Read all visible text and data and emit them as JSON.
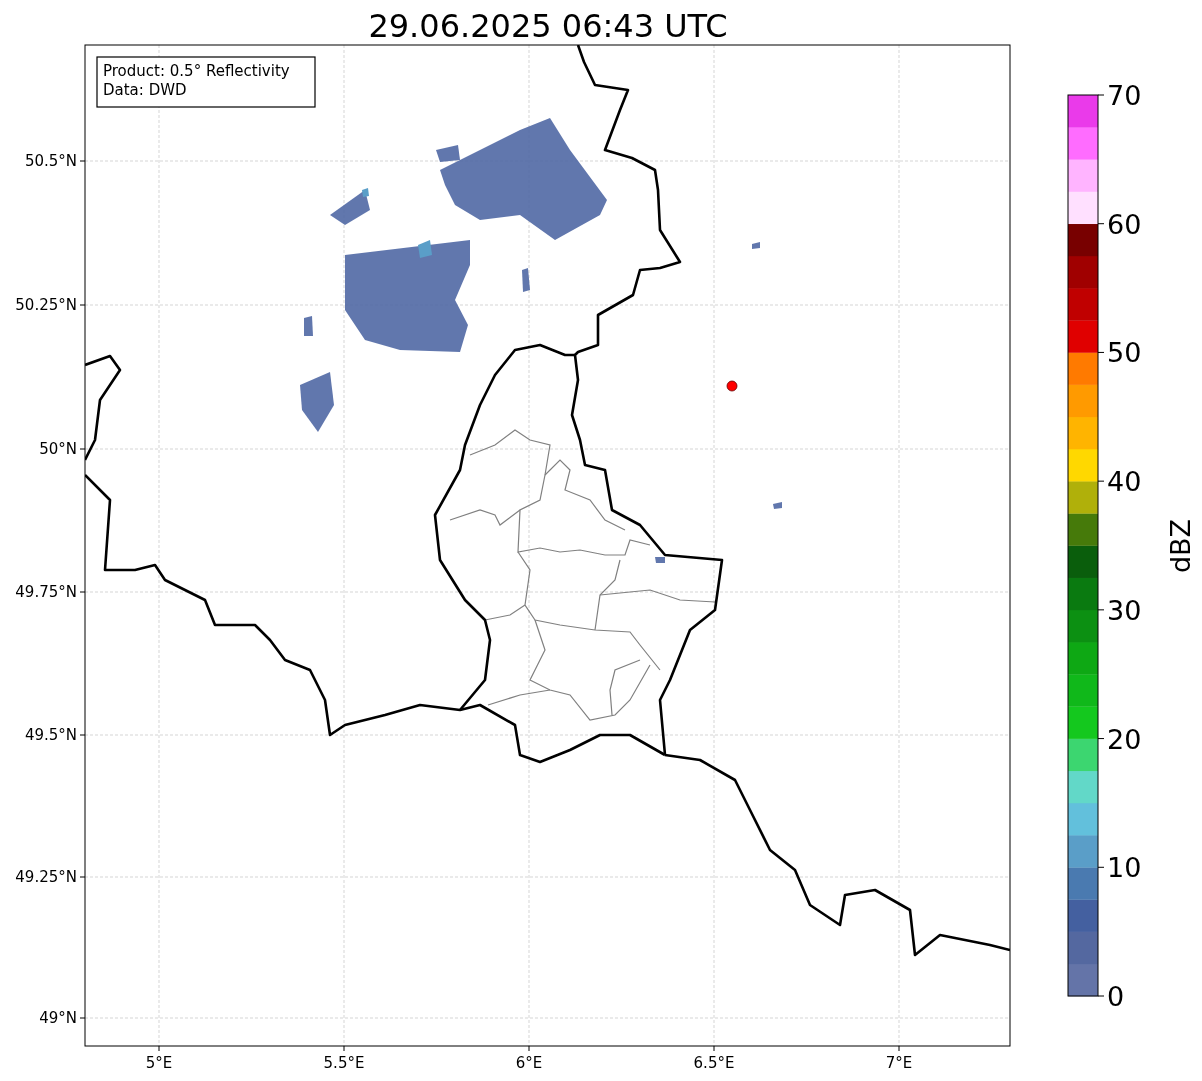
{
  "title": "29.06.2025 06:43 UTC",
  "info_box": {
    "lines": [
      "Product: 0.5° Reflectivity",
      "Data: DWD"
    ]
  },
  "map": {
    "x_ticks": [
      "5°E",
      "5.5°E",
      "6°E",
      "6.5°E",
      "7°E"
    ],
    "y_ticks": [
      "50.5°N",
      "50.25°N",
      "50°N",
      "49.75°N",
      "49.5°N",
      "49.25°N",
      "49°N"
    ]
  },
  "colorbar": {
    "label": "dBZ",
    "ticks": [
      "70",
      "60",
      "50",
      "40",
      "30",
      "20",
      "10",
      "0"
    ],
    "segments": [
      {
        "color": "#6474a8"
      },
      {
        "color": "#5468a0"
      },
      {
        "color": "#4460a0"
      },
      {
        "color": "#4a7ab0"
      },
      {
        "color": "#5a9ec8"
      },
      {
        "color": "#62c0dc"
      },
      {
        "color": "#62d8c8"
      },
      {
        "color": "#3cd670"
      },
      {
        "color": "#14c81e"
      },
      {
        "color": "#10b81a"
      },
      {
        "color": "#0ea814"
      },
      {
        "color": "#0c9012"
      },
      {
        "color": "#0a7a10"
      },
      {
        "color": "#0a5e0c"
      },
      {
        "color": "#467a0a"
      },
      {
        "color": "#b0b00a"
      },
      {
        "color": "#ffd800"
      },
      {
        "color": "#ffb400"
      },
      {
        "color": "#ff9a00"
      },
      {
        "color": "#ff7a00"
      },
      {
        "color": "#e00000"
      },
      {
        "color": "#c00000"
      },
      {
        "color": "#a00000"
      },
      {
        "color": "#780000"
      },
      {
        "color": "#ffe0ff"
      },
      {
        "color": "#ffb4ff"
      },
      {
        "color": "#ff6cff"
      },
      {
        "color": "#ea3aea"
      }
    ]
  }
}
